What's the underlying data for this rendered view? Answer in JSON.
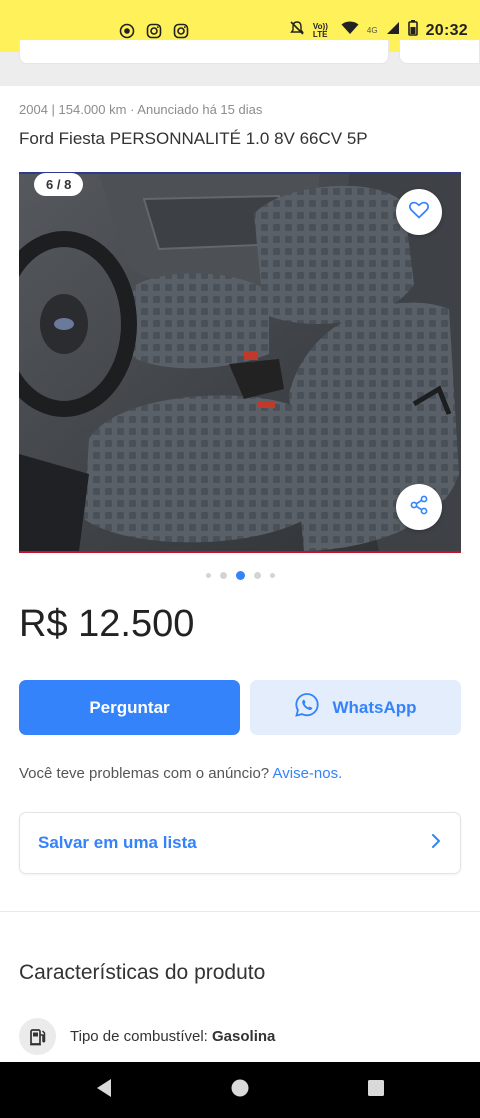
{
  "status_bar": {
    "time": "20:32",
    "network": "Vo)) LTE",
    "signal_label": "4G"
  },
  "listing": {
    "subtitle": "2004 | 154.000 km · Anunciado há 15 dias",
    "title": "Ford Fiesta PERSONNALITÉ 1.0 8V 66CV 5P",
    "gallery": {
      "counter": "6 / 8",
      "current_index": 3,
      "dots_visible": 5
    },
    "price": "R$ 12.500"
  },
  "actions": {
    "ask_label": "Perguntar",
    "whatsapp_label": "WhatsApp"
  },
  "report": {
    "text": "Você teve problemas com o anúncio?",
    "link": "Avise-nos."
  },
  "save_list": {
    "label": "Salvar em uma lista"
  },
  "characteristics": {
    "title": "Características do produto",
    "items": [
      {
        "label": "Tipo de combustível:",
        "value": "Gasolina",
        "icon": "fuel-pump-icon"
      }
    ]
  },
  "colors": {
    "header_yellow": "#fff159",
    "accent_blue": "#3483fa",
    "whatsapp_bg": "#e3edfb"
  }
}
